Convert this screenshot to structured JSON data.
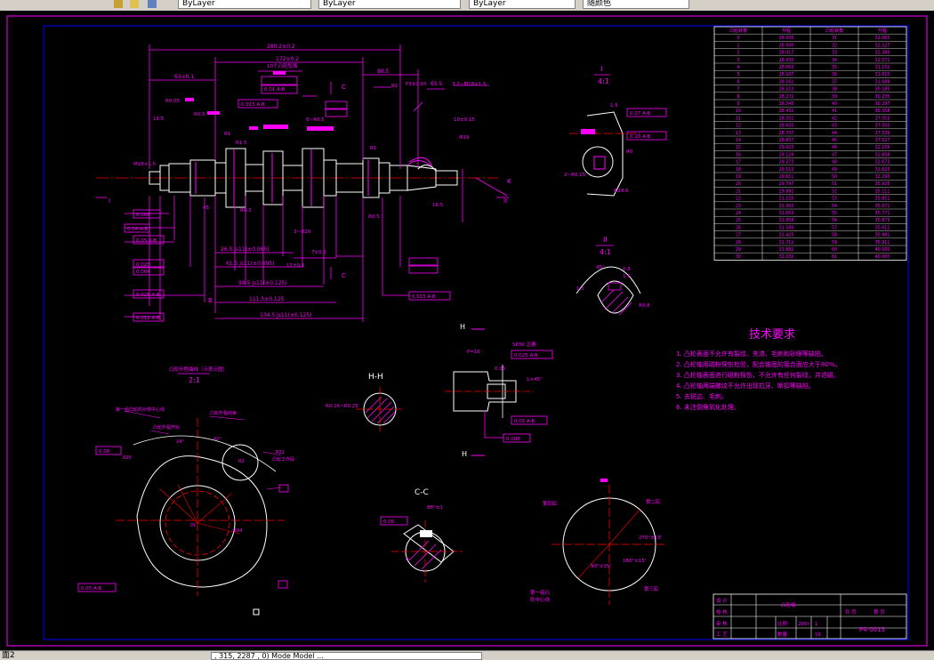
{
  "toolbar": {
    "layer_combo": "ByLayer",
    "color_combo": "ByLayer",
    "linetype_combo": "ByLayer",
    "plot_combo": "随颜色"
  },
  "status": {
    "left_text": "面2",
    "command_text": "  ,  315, 2287 , 0)  Mode  Model  ..."
  },
  "drawing": {
    "tech_title": "技术要求",
    "tech_reqs": [
      "1.   凸轮表面不允许有裂纹、夹渣、毛刺和砂眼等缺陷。",
      "2.   凸轮轴用磁粉探伤检验，配合锥面的接合面应大于80%。",
      "3.   凸轮轴表面进行磁粉探伤，不允许有任何裂纹，并退磁。",
      "4.   凸轮轴两端螺纹不允许出现拉牙、断扣等缺陷。",
      "5.   去锐边、毛刺。",
      "6.   未注倒角氧化处理。"
    ],
    "drawing_number": "P4-0013",
    "part_name": "凸轮轴",
    "scale_value": "1",
    "weight_value": "16",
    "qty_value": "200r",
    "tb_labels": [
      "设 计",
      "校 核",
      "审 核",
      "工 艺",
      "比例",
      "数量",
      "共 页",
      "第 页",
      "标记"
    ],
    "view_hh": "H-H",
    "view_cc": "C-C",
    "detail_I_num": "I",
    "detail_I_scale": "4:1",
    "detail_II_num": "II",
    "detail_II_scale": "4:1",
    "cam_scale": "2:1",
    "cam_title": "凸轮升程曲线（示意示图）",
    "top_dims": {
      "d1": "280.2±0.2",
      "d2": "172±0.2",
      "d3": "63±0.1",
      "d4": "88.5",
      "d5": "65.5"
    },
    "bottom_dims": [
      "26.5 js11(±0.065)",
      "61.5 js11(±0.095)",
      "99.5 js11(±0.125)",
      "111.5±0.125",
      "134.5 js11(±0.125)"
    ],
    "fcf_labels": [
      "0.05 A-B",
      "0.04 A-B",
      "0.025 A-B",
      "0.012 A-B",
      "0.015 A-B",
      "0.01 A-B",
      "0.05 A-B",
      "0.015 A-B",
      "0.025 A-B",
      "0.008",
      "0.025",
      "0.004"
    ],
    "misc_labels": [
      "A",
      "B",
      "C",
      "K",
      "H",
      "1",
      "2",
      "4",
      "R0.5",
      "R8",
      "R1",
      "Φ19",
      "Φ30",
      "R0.8",
      "R0.15",
      "1.5",
      "0.8",
      "45°",
      "16.5",
      "M18×1.5",
      "Rh1.6"
    ],
    "table": {
      "headers": [
        "凸轮转角",
        "升程",
        "凸轮转角",
        "升程"
      ],
      "rows": [
        [
          "0",
          "28.000",
          "31",
          "32.063"
        ],
        [
          "1",
          "28.000",
          "32",
          "32.227"
        ],
        [
          "2",
          "28.017",
          "33",
          "32.386"
        ],
        [
          "3",
          "28.030",
          "34",
          "32.571"
        ],
        [
          "4",
          "28.063",
          "35",
          "31.152"
        ],
        [
          "5",
          "28.107",
          "36",
          "31.610"
        ],
        [
          "6",
          "28.161",
          "37",
          "31.089"
        ],
        [
          "7",
          "28.210",
          "38",
          "30.185"
        ],
        [
          "8",
          "28.272",
          "39",
          "30.235"
        ],
        [
          "9",
          "28.345",
          "40",
          "30.297"
        ],
        [
          "10",
          "28.432",
          "41",
          "30.358"
        ],
        [
          "11",
          "28.551",
          "42",
          "37.553"
        ],
        [
          "12",
          "28.635",
          "43",
          "37.550"
        ],
        [
          "13",
          "28.737",
          "44",
          "37.539"
        ],
        [
          "14",
          "28.857",
          "45",
          "37.527"
        ],
        [
          "15",
          "29.023",
          "46",
          "32.156"
        ],
        [
          "16",
          "29.129",
          "47",
          "32.858"
        ],
        [
          "17",
          "29.273",
          "48",
          "32.673"
        ],
        [
          "18",
          "29.513",
          "49",
          "32.623"
        ],
        [
          "19",
          "29.611",
          "50",
          "32.293"
        ],
        [
          "20",
          "29.797",
          "51",
          "35.925"
        ],
        [
          "21",
          "29.992",
          "52",
          "35.111"
        ],
        [
          "22",
          "31.155",
          "53",
          "35.851"
        ],
        [
          "23",
          "31.350",
          "54",
          "35.571"
        ],
        [
          "24",
          "31.653",
          "55",
          "35.771"
        ],
        [
          "25",
          "31.858",
          "56",
          "35.873"
        ],
        [
          "26",
          "31.185",
          "57",
          "35.611"
        ],
        [
          "27",
          "31.425",
          "58",
          "35.981"
        ],
        [
          "28",
          "31.712",
          "59",
          "35.911"
        ],
        [
          "29",
          "31.892",
          "60",
          "40.000"
        ],
        [
          "30",
          "32.032",
          "61",
          "40.000"
        ]
      ]
    }
  }
}
